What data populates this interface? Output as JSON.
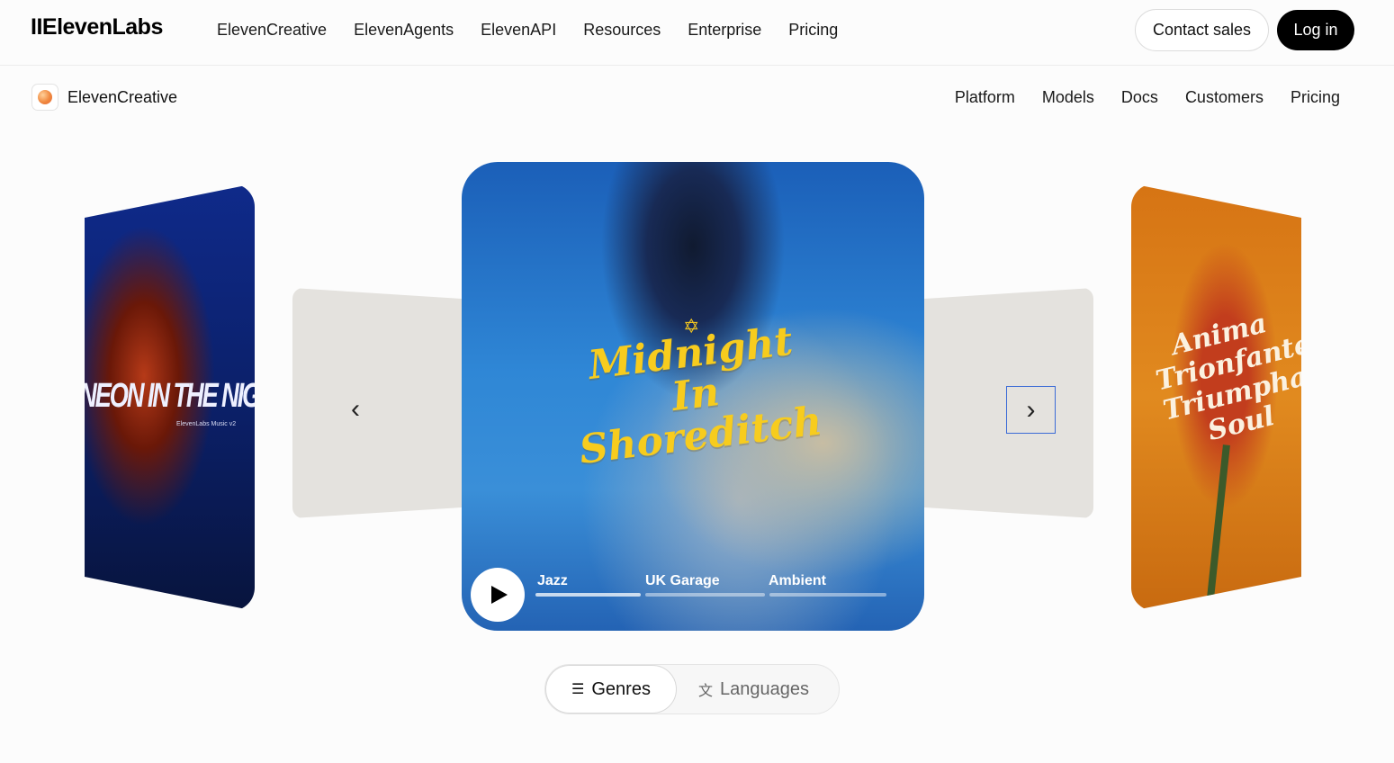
{
  "header": {
    "logo": "IIElevenLabs",
    "nav": [
      "ElevenCreative",
      "ElevenAgents",
      "ElevenAPI",
      "Resources",
      "Enterprise",
      "Pricing"
    ],
    "contact_label": "Contact sales",
    "login_label": "Log in"
  },
  "subheader": {
    "brand": "ElevenCreative",
    "nav": [
      "Platform",
      "Models",
      "Docs",
      "Customers",
      "Pricing"
    ]
  },
  "carousel": {
    "left_card": {
      "title": "NEON IN THE NIGHT",
      "subtitle": "ElevenLabs Music v2"
    },
    "main_card": {
      "title_lines": [
        "Midnight",
        "In",
        "Shoreditch"
      ],
      "tabs": [
        "Jazz",
        "UK Garage",
        "Ambient"
      ],
      "active_tab": "Jazz"
    },
    "right_card": {
      "title": "Anima Trionfante Triumphant Soul"
    },
    "prev_arrow": "‹",
    "next_arrow": "›"
  },
  "toggle": {
    "options": [
      {
        "label": "Genres",
        "icon": "music-list-icon",
        "active": true
      },
      {
        "label": "Languages",
        "icon": "translate-icon",
        "active": false
      }
    ]
  },
  "colors": {
    "accent_yellow": "#f7cc1e",
    "login_bg": "#000000",
    "focus_border": "#3b6bd6"
  }
}
